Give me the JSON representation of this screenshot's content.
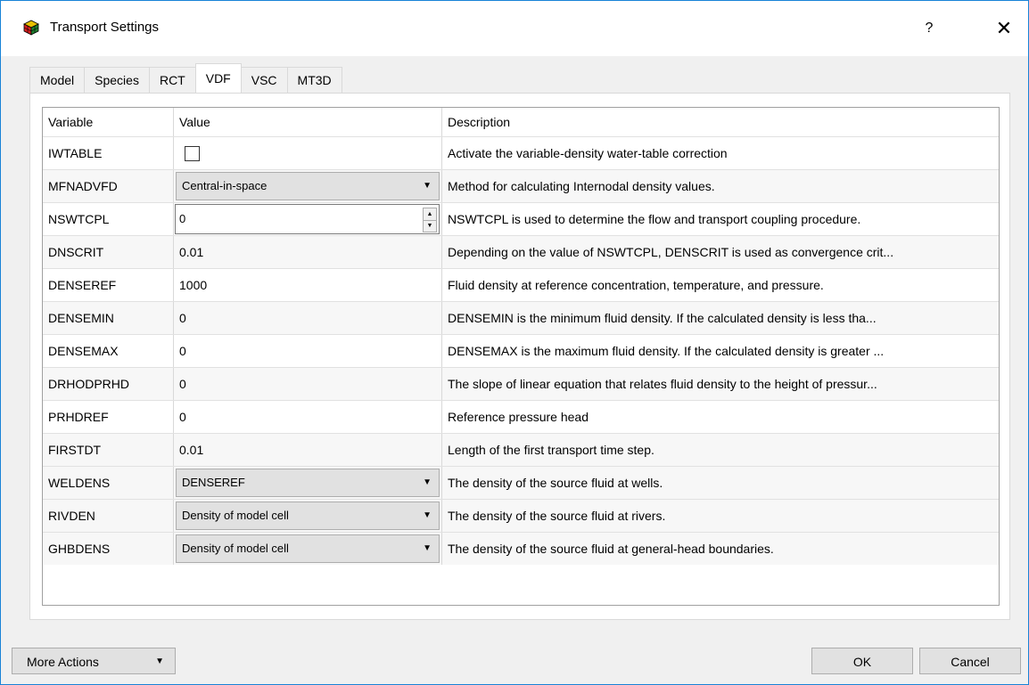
{
  "window": {
    "title": "Transport Settings",
    "help_label": "?",
    "close_label": "✕"
  },
  "tabs": [
    "Model",
    "Species",
    "RCT",
    "VDF",
    "VSC",
    "MT3D"
  ],
  "active_tab": "VDF",
  "grid": {
    "headers": {
      "variable": "Variable",
      "value": "Value",
      "description": "Description"
    },
    "rows": [
      {
        "variable": "IWTABLE",
        "value": "",
        "control": "checkbox",
        "checked": false,
        "description": "Activate the variable-density water-table correction"
      },
      {
        "variable": "MFNADVFD",
        "value": "Central-in-space",
        "control": "combo",
        "description": "Method for calculating Internodal density values."
      },
      {
        "variable": "NSWTCPL",
        "value": "0",
        "control": "spin",
        "description": "NSWTCPL is used to determine the flow and transport coupling procedure."
      },
      {
        "variable": "DNSCRIT",
        "value": "0.01",
        "control": "text",
        "description": "Depending on the value of NSWTCPL, DENSCRIT is used as convergence crit..."
      },
      {
        "variable": "DENSEREF",
        "value": "1000",
        "control": "text",
        "description": "Fluid density at reference concentration, temperature, and pressure."
      },
      {
        "variable": "DENSEMIN",
        "value": "0",
        "control": "text",
        "description": "DENSEMIN is the minimum fluid density. If the calculated density is less tha..."
      },
      {
        "variable": "DENSEMAX",
        "value": "0",
        "control": "text",
        "description": "DENSEMAX is the maximum fluid density. If the calculated density is greater ..."
      },
      {
        "variable": "DRHODPRHD",
        "value": "0",
        "control": "text",
        "description": "The slope of linear equation that relates fluid density to the height of pressur..."
      },
      {
        "variable": "PRHDREF",
        "value": "0",
        "control": "text",
        "description": "Reference pressure head"
      },
      {
        "variable": "FIRSTDT",
        "value": "0.01",
        "control": "text",
        "description": "Length of the first transport time step."
      },
      {
        "variable": "WELDENS",
        "value": "DENSEREF",
        "control": "combo",
        "description": "The density of the source fluid at wells."
      },
      {
        "variable": "RIVDEN",
        "value": "Density of model cell",
        "control": "combo",
        "description": "The density of the source fluid at rivers."
      },
      {
        "variable": "GHBDENS",
        "value": "Density of model cell",
        "control": "combo",
        "description": "The density of the source fluid at general-head boundaries."
      }
    ]
  },
  "footer": {
    "more_actions_label": "More Actions",
    "ok_label": "OK",
    "cancel_label": "Cancel"
  },
  "colors": {
    "accent_border": "#1883d7",
    "dialog_bg": "#f0f0f0",
    "button_bg": "#e1e1e1"
  }
}
